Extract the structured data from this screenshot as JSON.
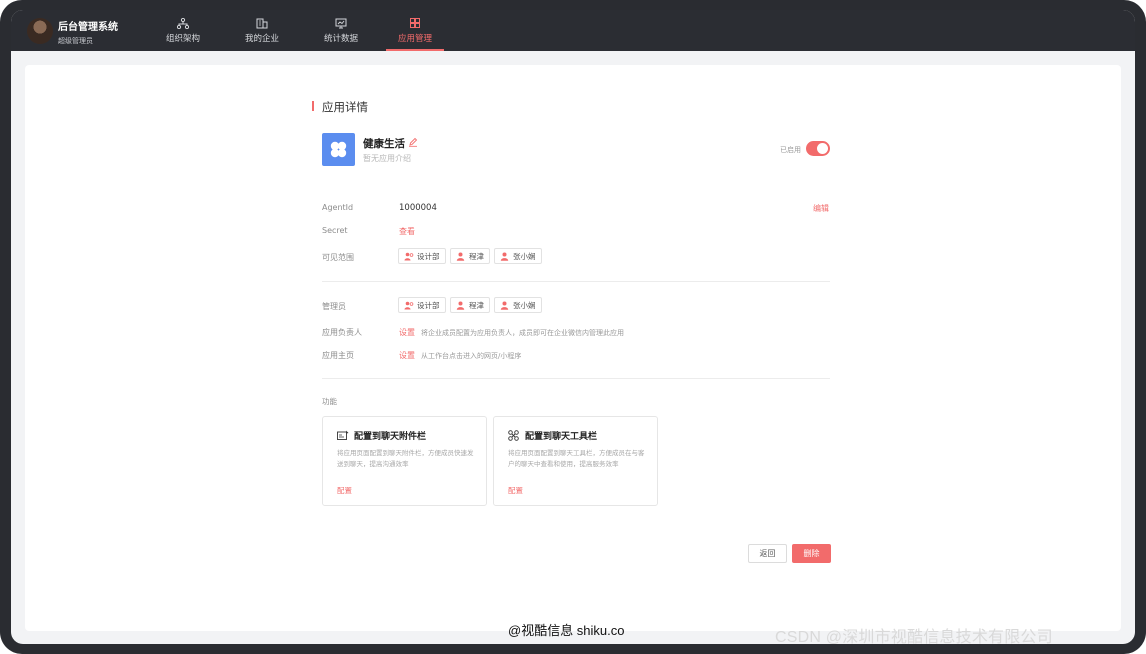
{
  "brand": {
    "title": "后台管理系统",
    "subtitle": "超级管理员"
  },
  "nav": [
    {
      "label": "组织架构",
      "icon": "org-chart-icon"
    },
    {
      "label": "我的企业",
      "icon": "building-icon"
    },
    {
      "label": "统计数据",
      "icon": "stats-icon"
    },
    {
      "label": "应用管理",
      "icon": "apps-grid-icon",
      "active": true
    }
  ],
  "page": {
    "section_title": "应用详情"
  },
  "app": {
    "name": "健康生活",
    "desc": "暂无应用介绍",
    "status_label": "已启用",
    "enabled": true
  },
  "details": {
    "agent_label": "AgentId",
    "agent_value": "1000004",
    "edit_label": "编辑",
    "secret_label": "Secret",
    "secret_action": "查看",
    "scope_label": "可见范围",
    "scope_chips": [
      "设计部",
      "程津",
      "张小娴"
    ]
  },
  "admin": {
    "admins_label": "管理员",
    "admin_chips": [
      "设计部",
      "程津",
      "张小娴"
    ],
    "owner_label": "应用负责人",
    "owner_action": "设置",
    "owner_hint": "将企业成员配置为应用负责人，成员即可在企业微信内管理此应用",
    "home_label": "应用主页",
    "home_action": "设置",
    "home_hint": "从工作台点击进入的网页/小程序"
  },
  "functions": {
    "label": "功能",
    "cards": [
      {
        "title": "配置到聊天附件栏",
        "desc": "将应用页面配置到聊天附件栏，方便成员快速发送到聊天，提高沟通效率",
        "action": "配置",
        "icon": "attachment-bar-icon"
      },
      {
        "title": "配置到聊天工具栏",
        "desc": "将应用页面配置到聊天工具栏，方便成员在与客户的聊天中查看和使用，提高服务效率",
        "action": "配置",
        "icon": "toolbar-icon"
      }
    ]
  },
  "buttons": {
    "back": "返回",
    "delete": "删除"
  },
  "watermarks": {
    "left": "@视酷信息 shiku.co",
    "right": "CSDN @深圳市视酷信息技术有限公司"
  },
  "colors": {
    "accent": "#f26b6b",
    "topbar": "#2b2d33",
    "app_icon": "#5b8def"
  }
}
